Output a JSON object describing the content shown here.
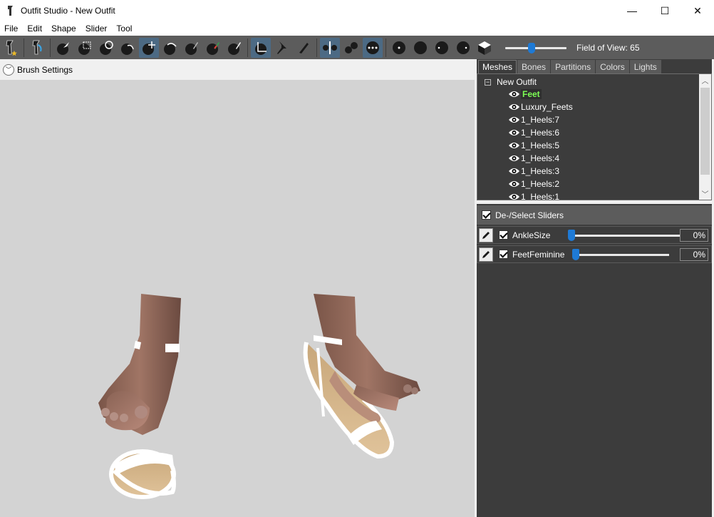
{
  "window": {
    "title": "Outfit Studio - New Outfit",
    "minimize": "—",
    "maximize": "☐",
    "close": "✕"
  },
  "menu": [
    "File",
    "Edit",
    "Shape",
    "Slider",
    "Tool"
  ],
  "toolbar": {
    "field_of_view_label": "Field of View: 65",
    "field_of_view": 65
  },
  "brush_settings": {
    "label": "Brush Settings"
  },
  "tabs": [
    "Meshes",
    "Bones",
    "Partitions",
    "Colors",
    "Lights"
  ],
  "active_tab": "Meshes",
  "mesh_tree": {
    "root": "New Outfit",
    "items": [
      "Feet",
      "Luxury_Feets",
      "1_Heels:7",
      "1_Heels:6",
      "1_Heels:5",
      "1_Heels:4",
      "1_Heels:3",
      "1_Heels:2",
      "1_Heels:1"
    ],
    "selected": "Feet"
  },
  "sliders_panel": {
    "deselect_label": "De-/Select Sliders",
    "sliders": [
      {
        "name": "AnkleSize",
        "value": "0%"
      },
      {
        "name": "FeetFeminine",
        "value": "0%"
      }
    ]
  },
  "colors": {
    "toolbar_bg": "#5c5c5c",
    "panel_bg": "#3c3c3c",
    "viewport_bg": "#d3d3d3",
    "accent": "#1e7ad6",
    "selected_text": "#7dff55"
  }
}
